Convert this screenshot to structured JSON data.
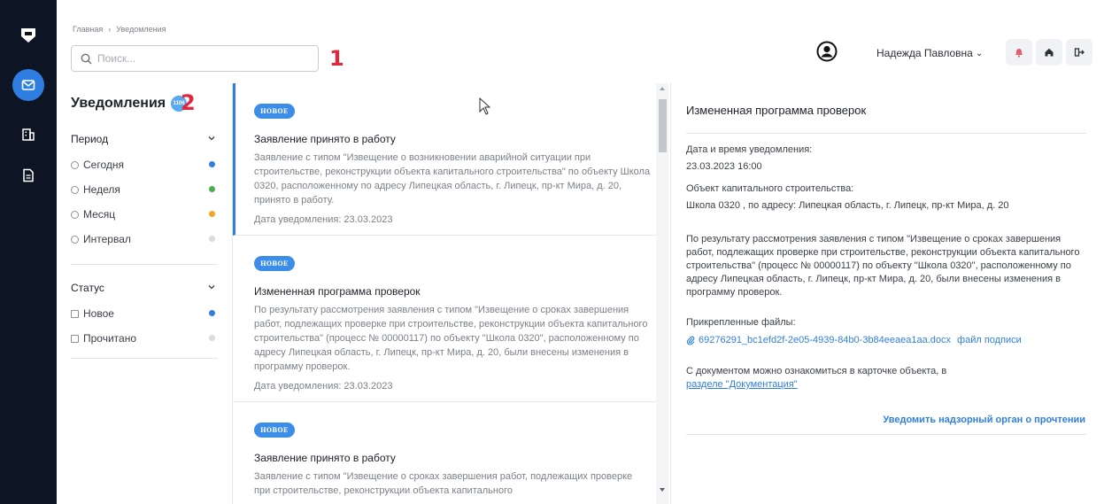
{
  "breadcrumb": {
    "home": "Главная",
    "separator": "›",
    "current": "Уведомления"
  },
  "search": {
    "placeholder": "Поиск..."
  },
  "annotations": {
    "a1": "1",
    "a2": "2"
  },
  "user": {
    "name": "Надежда Павловна",
    "chevron": "⌄"
  },
  "rail": {
    "icons": [
      "logo-icon",
      "envelope-icon",
      "building-icon",
      "document-icon"
    ]
  },
  "filters": {
    "title": "Уведомления",
    "count": "1106",
    "period": {
      "label": "Период",
      "options": [
        {
          "label": "Сегодня",
          "color": "#2f7fe3"
        },
        {
          "label": "Неделя",
          "color": "#4caf50"
        },
        {
          "label": "Месяц",
          "color": "#f5a623"
        },
        {
          "label": "Интервал",
          "color": "#d9dbe0"
        }
      ]
    },
    "status": {
      "label": "Статус",
      "options": [
        {
          "label": "Новое",
          "color": "#2f7fe3"
        },
        {
          "label": "Прочитано",
          "color": "#d9dbe0"
        }
      ]
    }
  },
  "list": {
    "items": [
      {
        "badge": "НОВОЕ",
        "title": "Заявление принято в работу",
        "text": "Заявление с типом \"Извещение о возникновении аварийной ситуации при строительстве, реконструкции объекта капитального строительства\" по объекту Школа 0320, расположенному по адресу Липецкая область, г. Липецк, пр-кт Мира, д. 20, принято в работу.",
        "date": "Дата уведомления: 23.03.2023"
      },
      {
        "badge": "НОВОЕ",
        "title": "Измененная программа проверок",
        "text": "По результату рассмотрения заявления с типом \"Извещение о сроках завершения работ, подлежащих проверке при строительстве, реконструкции объекта капитального строительства\" (процесс № 00000117) по объекту \"Школа 0320\", расположенному по адресу Липецкая область, г. Липецк, пр-кт Мира, д. 20, были внесены изменения в программу проверок.",
        "date": "Дата уведомления: 23.03.2023"
      },
      {
        "badge": "НОВОЕ",
        "title": "Заявление принято в работу",
        "text": "Заявление с типом \"Извещение о сроках завершения работ, подлежащих проверке при строительстве, реконструкции объекта капитального",
        "date": ""
      }
    ]
  },
  "detail": {
    "title": "Измененная программа проверок",
    "datetime_label": "Дата и время уведомления:",
    "datetime_value": "23.03.2023 16:00",
    "object_label": "Объект капитального строительства:",
    "object_value": "Школа 0320 , по адресу: Липецкая область, г. Липецк, пр-кт Мира, д. 20",
    "body": "По результату рассмотрения заявления с типом \"Извещение о сроках завершения работ, подлежащих проверке при строительстве, реконструкции объекта капитального строительства\" (процесс № 00000117) по объекту \"Школа 0320\", расположенному по адресу Липецкая область, г. Липецк, пр-кт Мира, д. 20, были внесены изменения в программу проверок.",
    "files_label": "Прикрепленные файлы:",
    "file_name": "69276291_bc1efd2f-2e05-4939-84b0-3b84eeaea1aa.docx",
    "signature_link": "файл подписи",
    "doc_note": "С документом можно ознакомиться в карточке объекта, в",
    "doc_link": "разделе \"Документация\"",
    "notify_button": "Уведомить надзорный орган о прочтении"
  }
}
